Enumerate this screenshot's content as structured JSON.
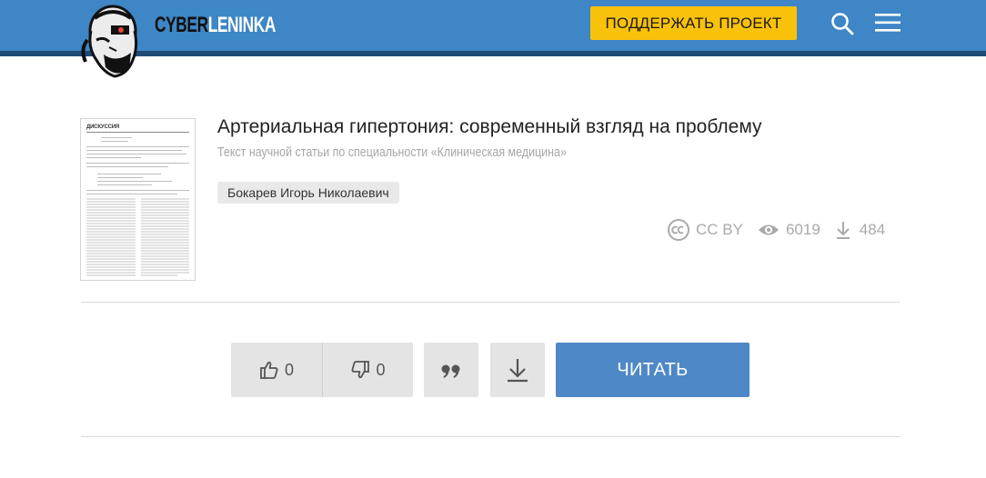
{
  "header": {
    "logo_part1": "CYBER",
    "logo_part2": "LENINKA",
    "support_label": "ПОДДЕРЖАТЬ ПРОЕКТ",
    "search_icon": "search-icon",
    "menu_icon": "hamburger-menu-icon",
    "accent_color": "#3e86c6",
    "support_color": "#f9c20a"
  },
  "article": {
    "thumbnail_heading": "ДИСКУССИЯ",
    "title": "Артериальная гипертония: современный взгляд на проблему",
    "subtitle": "Текст научной статьи по специальности «Клиническая медицина»",
    "author": "Бокарев Игорь Николаевич",
    "license": "CC BY",
    "views": "6019",
    "downloads": "484"
  },
  "actions": {
    "likes": "0",
    "dislikes": "0",
    "quote_icon": "quote-icon",
    "download_icon": "download-icon",
    "read_label": "ЧИТАТЬ",
    "read_color": "#4f88c6"
  }
}
